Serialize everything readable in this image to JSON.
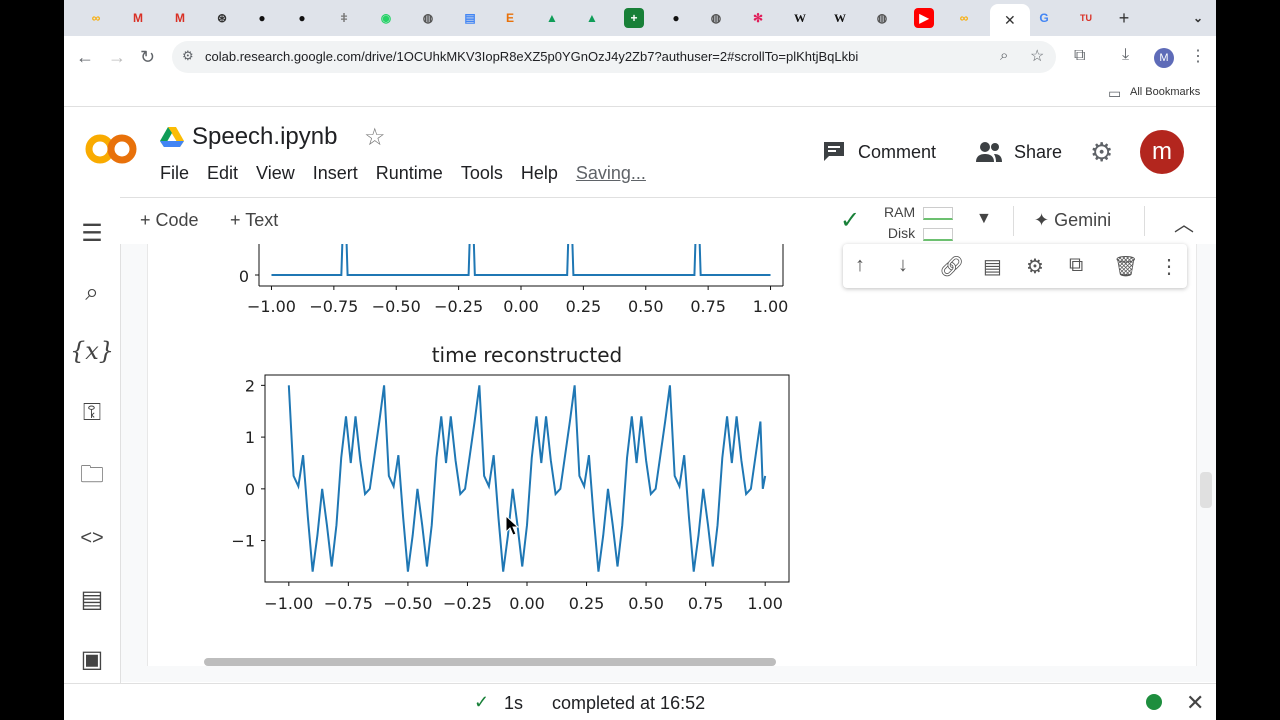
{
  "browser": {
    "url": "colab.research.google.com/drive/1OCUhkMKV3IopR8eXZ5p0YGnOzJ4y2Zb7?authuser=2#scrollTo=plKhtjBqLkbi",
    "bookmarks_label": "All Bookmarks",
    "new_tab": "+",
    "user_initial": "M"
  },
  "colab": {
    "notebook_title": "Speech.ipynb",
    "menus": [
      "File",
      "Edit",
      "View",
      "Insert",
      "Runtime",
      "Tools",
      "Help"
    ],
    "saving": "Saving...",
    "comment": "Comment",
    "share": "Share",
    "avatar": "m"
  },
  "toolbar": {
    "add_code": "Code",
    "add_text": "Text",
    "ram": "RAM",
    "disk": "Disk",
    "gemini": "Gemini"
  },
  "status": {
    "duration": "1s",
    "completed": "completed at 16:52"
  },
  "chart_data": [
    {
      "type": "line",
      "title": "",
      "x_ticks": [
        "−1.00",
        "−0.75",
        "−0.50",
        "−0.25",
        "0.00",
        "0.25",
        "0.50",
        "0.75",
        "1.00"
      ],
      "y_ticks": [
        "0"
      ],
      "xlim": [
        -1.05,
        1.05
      ],
      "series": [
        {
          "x": [
            -1.0,
            -0.72,
            -0.715,
            -0.7,
            -0.695,
            -0.21,
            -0.205,
            -0.19,
            -0.185,
            0.185,
            0.19,
            0.205,
            0.21,
            0.695,
            0.7,
            0.715,
            0.72,
            1.0
          ],
          "y": [
            0,
            0,
            1,
            1,
            0,
            0,
            1,
            1,
            0,
            0,
            1,
            1,
            0,
            0,
            1,
            1,
            0,
            0
          ]
        }
      ],
      "color": "#1f77b4",
      "note_cropped": true
    },
    {
      "type": "line",
      "title": "time reconstructed",
      "x_ticks": [
        "−1.00",
        "−0.75",
        "−0.50",
        "−0.25",
        "0.00",
        "0.25",
        "0.50",
        "0.75",
        "1.00"
      ],
      "y_ticks": [
        "2",
        "1",
        "0",
        "−1"
      ],
      "xlim": [
        -1.1,
        1.1
      ],
      "ylim": [
        -1.8,
        2.2
      ],
      "period": 0.4,
      "start_value": 2.0,
      "end_value": 0.25,
      "period_values": [
        2.0,
        0.25,
        0.05,
        0.65,
        -0.55,
        -1.6,
        -0.9,
        0.0,
        -0.7,
        -1.5,
        -0.7,
        0.6,
        1.4,
        0.5,
        1.4,
        0.55,
        -0.1,
        0.0,
        0.65,
        1.3
      ],
      "color": "#1f77b4"
    }
  ]
}
